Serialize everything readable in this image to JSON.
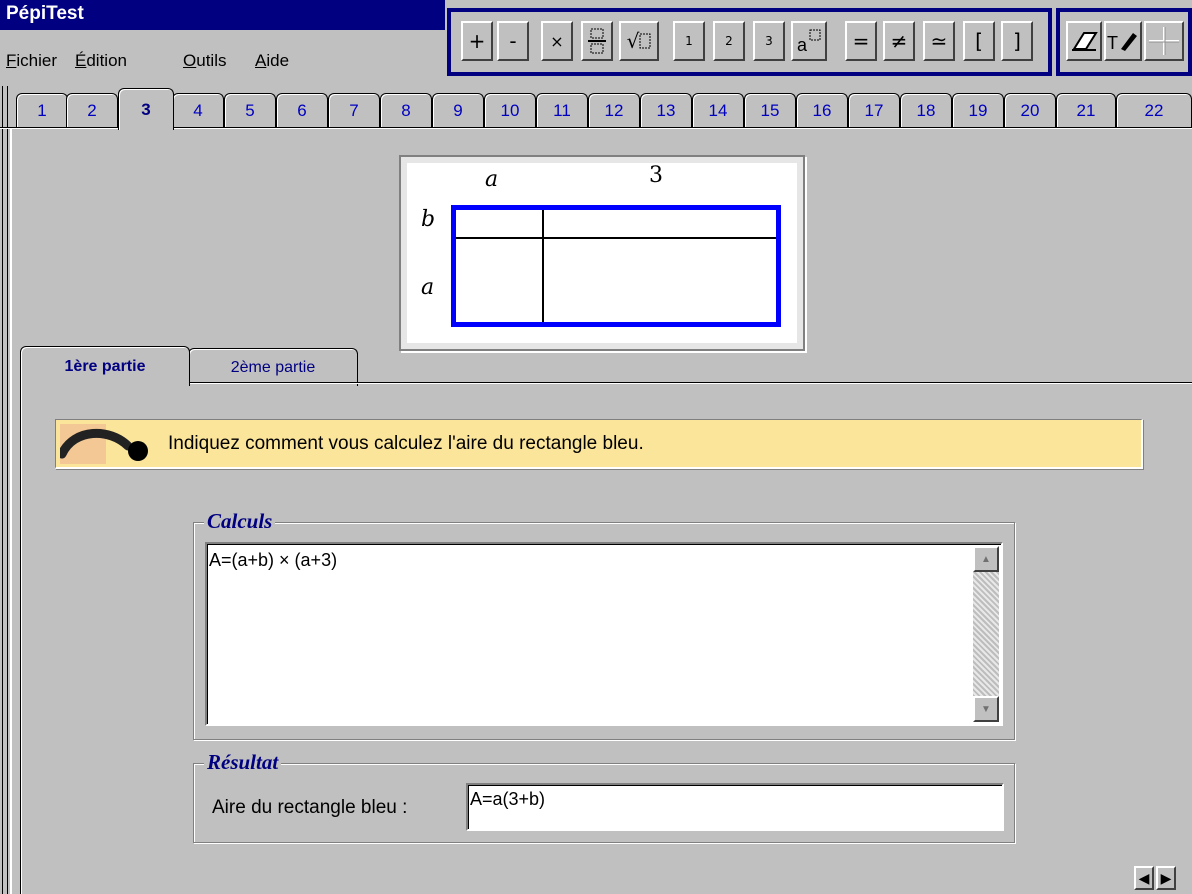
{
  "app": {
    "title": "PépiTest"
  },
  "menu": [
    {
      "label": "Fichier",
      "mnemonic": "F",
      "rest": "ichier"
    },
    {
      "label": "Édition",
      "mnemonic": "É",
      "rest": "dition"
    },
    {
      "label": "Outils",
      "mnemonic": "O",
      "rest": "utils"
    },
    {
      "label": "Aide",
      "mnemonic": "A",
      "rest": "ide"
    }
  ],
  "toolbar": {
    "plus": "+",
    "minus": "-",
    "times": "×",
    "fraction_icon": "fraction-icon",
    "sqrt": "√",
    "sup1": "1",
    "sup2": "2",
    "sup3": "3",
    "power_icon": "power-icon",
    "equals": "=",
    "not_equal": "≠",
    "approx": "≃",
    "lbracket": "[",
    "rbracket": "]",
    "eraser_icon": "eraser-icon",
    "text_pen_icon": "text-pen-icon",
    "crosshair_icon": "crosshair-icon"
  },
  "page_tabs": [
    "1",
    "2",
    "3",
    "4",
    "5",
    "6",
    "7",
    "8",
    "9",
    "10",
    "11",
    "12",
    "13",
    "14",
    "15",
    "16",
    "17",
    "18",
    "19",
    "20",
    "21",
    "22"
  ],
  "active_page_tab": "3",
  "figure": {
    "top_left": "a",
    "top_right": "3",
    "left_top": "b",
    "left_bottom": "a",
    "border_color": "#0000ff"
  },
  "sub_tabs": {
    "first": "1ère partie",
    "second": "2ème partie",
    "active": "1ère partie"
  },
  "instruction": "Indiquez comment vous calculez l'aire du rectangle bleu.",
  "calculs": {
    "legend": "Calculs",
    "value": "A=(a+b) × (a+3)"
  },
  "resultat": {
    "legend": "Résultat",
    "label": "Aire du rectangle bleu :",
    "value": "A=a(3+b)"
  },
  "colors": {
    "titlebar": "#000080",
    "tab_text": "#0000c0",
    "banner": "#fbe59a",
    "legend": "#000080"
  }
}
